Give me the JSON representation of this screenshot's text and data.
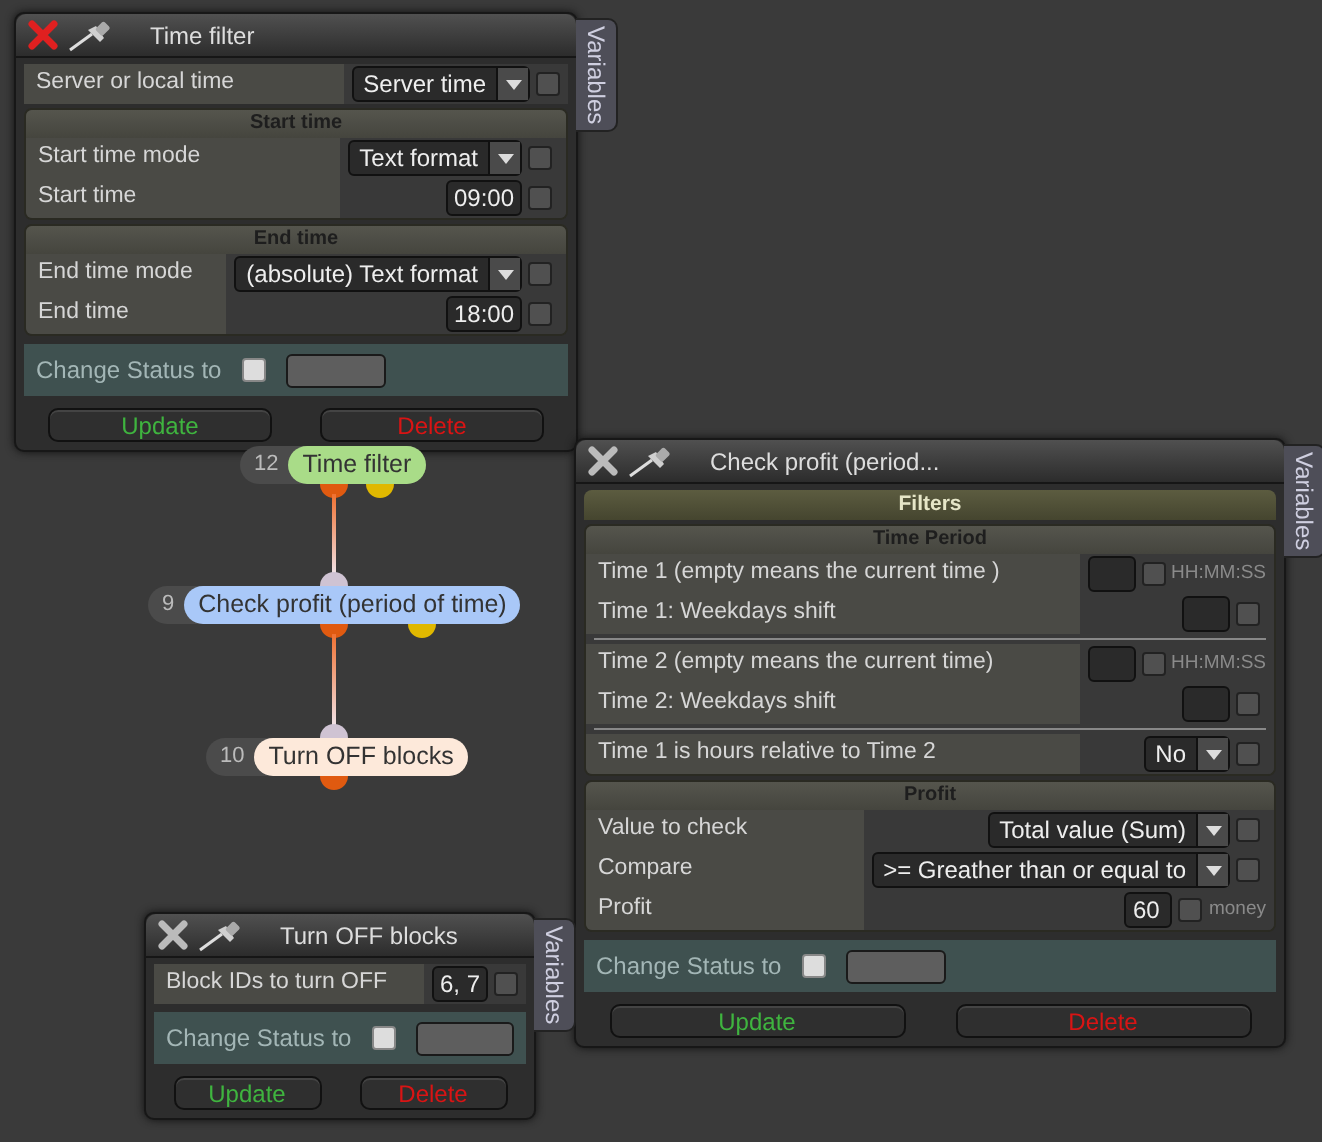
{
  "panels": [
    {
      "title": "Time filter",
      "active": true,
      "side_tab": "Variables",
      "body": [
        {
          "kind": "row",
          "label": "Server or local time",
          "control": {
            "kind": "select",
            "value": "Server time"
          },
          "checked": false
        },
        {
          "kind": "section",
          "title": "Start time",
          "children": [
            {
              "kind": "row",
              "label": "Start time mode",
              "control": {
                "kind": "select",
                "value": "Text format"
              },
              "checked": false
            },
            {
              "kind": "row",
              "label": "Start time",
              "control": {
                "kind": "input",
                "value": "09:00"
              },
              "checked": false
            }
          ]
        },
        {
          "kind": "section",
          "title": "End time",
          "children": [
            {
              "kind": "row",
              "label": "End time mode",
              "control": {
                "kind": "select",
                "value": "(absolute) Text format"
              },
              "checked": false
            },
            {
              "kind": "row",
              "label": "End time",
              "control": {
                "kind": "input",
                "value": "18:00"
              },
              "checked": false
            }
          ]
        }
      ],
      "status": {
        "label": "Change Status to",
        "checked": false
      },
      "buttons": [
        {
          "label": "Update",
          "kind": "update"
        },
        {
          "label": "Delete",
          "kind": "delete"
        }
      ]
    },
    {
      "title": "Check profit (period...",
      "active": false,
      "side_tab": "Variables",
      "body": [
        {
          "kind": "group",
          "title": "Filters",
          "children": [
            {
              "kind": "section",
              "title": "Time Period",
              "children": [
                {
                  "kind": "row",
                  "label": "Time 1 (empty means the current time )",
                  "control": {
                    "kind": "input"
                  },
                  "checked": false,
                  "hint": "HH:MM:SS"
                },
                {
                  "kind": "row",
                  "label": "Time 1: Weekdays shift",
                  "control": {
                    "kind": "input"
                  },
                  "checked": false
                },
                {
                  "kind": "divider"
                },
                {
                  "kind": "row",
                  "label": "Time 2 (empty means the current time)",
                  "control": {
                    "kind": "input"
                  },
                  "checked": false,
                  "hint": "HH:MM:SS"
                },
                {
                  "kind": "row",
                  "label": "Time 2: Weekdays shift",
                  "control": {
                    "kind": "input"
                  },
                  "checked": false
                },
                {
                  "kind": "divider"
                },
                {
                  "kind": "row",
                  "label": "Time 1 is hours relative to Time 2",
                  "control": {
                    "kind": "select",
                    "value": "No"
                  },
                  "checked": false
                }
              ]
            },
            {
              "kind": "section",
              "title": "Profit",
              "children": [
                {
                  "kind": "row",
                  "label": "Value to check",
                  "control": {
                    "kind": "select",
                    "value": "Total value (Sum)"
                  },
                  "checked": false
                },
                {
                  "kind": "row",
                  "label": "Compare",
                  "control": {
                    "kind": "select",
                    "value": ">= Greather than or equal to"
                  },
                  "checked": false
                },
                {
                  "kind": "row",
                  "label": "Profit",
                  "control": {
                    "kind": "input",
                    "value": "60"
                  },
                  "checked": false,
                  "hint": "money"
                }
              ]
            }
          ]
        }
      ],
      "status": {
        "label": "Change Status to",
        "checked": false
      },
      "buttons": [
        {
          "label": "Update",
          "kind": "update"
        },
        {
          "label": "Delete",
          "kind": "delete"
        }
      ]
    },
    {
      "title": "Turn OFF blocks",
      "active": false,
      "side_tab": "Variables",
      "body": [
        {
          "kind": "row",
          "label": "Block IDs to turn OFF",
          "control": {
            "kind": "input",
            "value": "6, 7"
          },
          "checked": false
        }
      ],
      "status": {
        "label": "Change Status to",
        "checked": false
      },
      "buttons": [
        {
          "label": "Update",
          "kind": "update"
        },
        {
          "label": "Delete",
          "kind": "delete"
        }
      ]
    }
  ],
  "graph": {
    "nodes": [
      {
        "number": "12",
        "label": "Time filter",
        "color": "#a9dc88"
      },
      {
        "number": "9",
        "label": "Check profit (period of time)",
        "color": "#a9c8f8"
      },
      {
        "number": "10",
        "label": "Turn OFF blocks",
        "color": "#fde9da"
      }
    ]
  }
}
